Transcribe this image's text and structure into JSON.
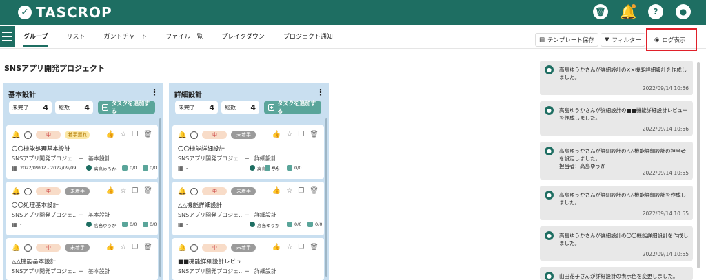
{
  "app": {
    "logo_text": "TASCROP",
    "header_icons": [
      "trash-icon",
      "bell-icon",
      "help-icon",
      "user-icon"
    ],
    "brand_color": "#1e6e62"
  },
  "tabs": [
    {
      "label": "グループ",
      "active": true
    },
    {
      "label": "リスト"
    },
    {
      "label": "ガントチャート"
    },
    {
      "label": "ファイル一覧"
    },
    {
      "label": "ブレイクダウン"
    },
    {
      "label": "プロジェクト通知"
    }
  ],
  "toolbar": {
    "template_save": "テンプレート保存",
    "filter": "フィルター",
    "log_view": "ログ表示"
  },
  "project_title": "SNSアプリ開発プロジェクト",
  "columns": [
    {
      "title": "基本設計",
      "incomplete_label": "未完了",
      "incomplete_count": "4",
      "total_label": "総数",
      "total_count": "4",
      "add_label": "タスクを追加する",
      "cards": [
        {
          "priority": "中",
          "status": "着手遅れ",
          "status_type": "late",
          "name": "〇〇機能処理基本設計",
          "project": "SNSアプリ開発プロジェ...",
          "phase": "─　基本設計",
          "dates": "2022/09/02 - 2022/09/09",
          "assignee": "高島ゆうか",
          "sub": "0/0",
          "docs": "0/0"
        },
        {
          "priority": "中",
          "status": "未着手",
          "status_type": "todo",
          "name": "〇〇処理基本設計",
          "project": "SNSアプリ開発プロジェ...",
          "phase": "─　基本設計",
          "dates": "-",
          "assignee": "高島ゆうか",
          "sub": "0/0",
          "docs": "0/0"
        },
        {
          "priority": "中",
          "status": "未着手",
          "status_type": "todo",
          "name": "△△機能基本設計",
          "project": "SNSアプリ開発プロジェ...",
          "phase": "─　基本設計",
          "dates": "-",
          "assignee": "高島ゆうか",
          "sub": "0/0",
          "docs": "0/0"
        }
      ]
    },
    {
      "title": "詳細設計",
      "incomplete_label": "未完了",
      "incomplete_count": "4",
      "total_label": "総数",
      "total_count": "4",
      "add_label": "タスクを追加する",
      "cards": [
        {
          "priority": "中",
          "status": "未着手",
          "status_type": "todo",
          "name": "〇〇機能詳細設計",
          "project": "SNSアプリ開発プロジェ...",
          "phase": "─　詳細設計",
          "dates": "-",
          "assignee": "高島ゆうか",
          "sub": "0/0",
          "docs": "0/0"
        },
        {
          "priority": "中",
          "status": "未着手",
          "status_type": "todo",
          "name": "△△機能詳細設計",
          "project": "SNSアプリ開発プロジェ...",
          "phase": "─　詳細設計",
          "dates": "-",
          "assignee": "高島ゆうか",
          "sub": "0/0",
          "docs": "0/0"
        },
        {
          "priority": "中",
          "status": "未着手",
          "status_type": "todo",
          "name": "■■機能詳細設計レビュー",
          "project": "SNSアプリ開発プロジェ...",
          "phase": "─　詳細設計",
          "dates": "-",
          "assignee": "高島ゆうか",
          "sub": "0/0",
          "docs": "0/0"
        }
      ]
    }
  ],
  "logs": [
    {
      "text": "高島ゆうかさんが詳細設計の××機能詳細設計を作成しました。",
      "time": "2022/09/14 10:56"
    },
    {
      "text": "高島ゆうかさんが詳細設計の■■機能詳細設計レビューを作成しました。",
      "time": "2022/09/14 10:56"
    },
    {
      "text": "高島ゆうかさんが詳細設計の△△機能詳細設計の担当者を設定しました。\n担当者：高島ゆうか",
      "time": "2022/09/14 10:55"
    },
    {
      "text": "高島ゆうかさんが詳細設計の△△機能詳細設計を作成しました。",
      "time": "2022/09/14 10:55"
    },
    {
      "text": "高島ゆうかさんが詳細設計の〇〇機能詳細設計を作成しました。",
      "time": "2022/09/14 10:55"
    },
    {
      "text": "山田花子さんが詳細設計の表示色を変更しました。",
      "time": ""
    }
  ]
}
